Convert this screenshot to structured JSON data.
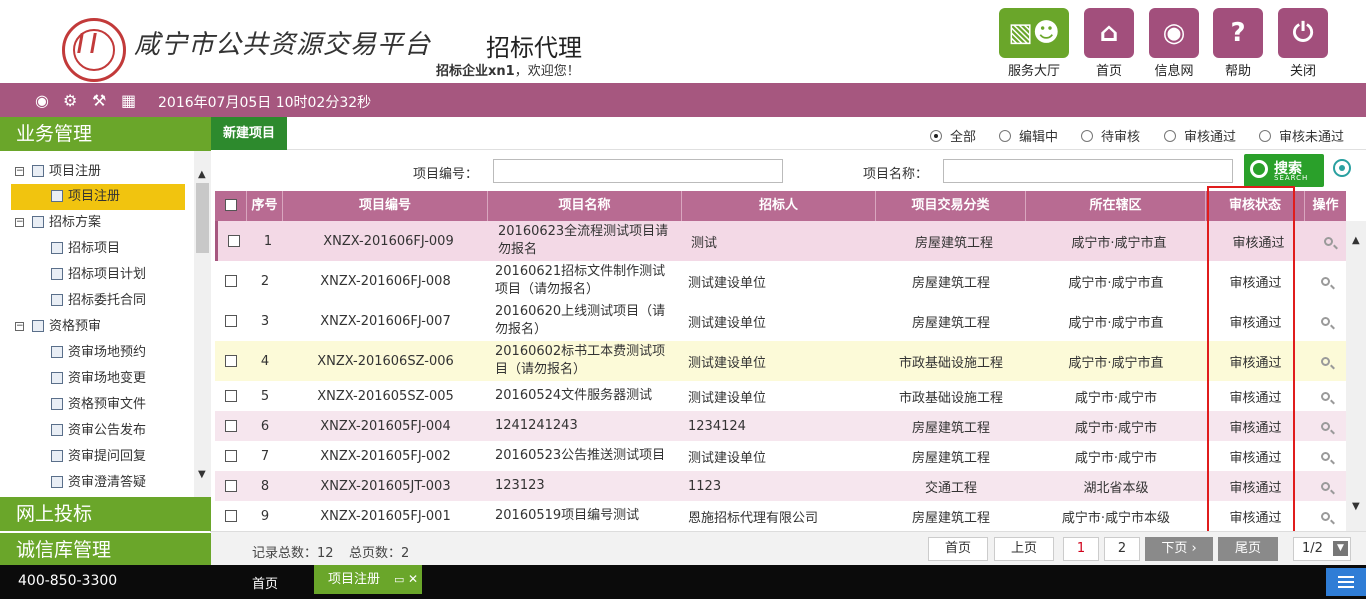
{
  "header": {
    "site_title": "咸宁市公共资源交易平台",
    "module_title": "招标代理",
    "welcome_user": "招标企业xn1",
    "welcome_text": "，欢迎您！",
    "buttons": [
      {
        "label": "服务大厅",
        "icon": "service-hall-icon"
      },
      {
        "label": "首页",
        "icon": "home-icon"
      },
      {
        "label": "信息网",
        "icon": "globe-icon"
      },
      {
        "label": "帮助",
        "icon": "help-icon"
      },
      {
        "label": "关闭",
        "icon": "power-icon"
      }
    ]
  },
  "topbar": {
    "datetime": "2016年07月05日 10时02分32秒",
    "icons": [
      "chat-icon",
      "gear-icon",
      "tools-icon",
      "gift-icon"
    ]
  },
  "sidebar": {
    "sections": [
      "业务管理",
      "网上投标",
      "诚信库管理"
    ],
    "tree": [
      {
        "label": "项目注册",
        "level": 0,
        "expand": "⊟"
      },
      {
        "label": "项目注册",
        "level": 1,
        "selected": true
      },
      {
        "label": "招标方案",
        "level": 0,
        "expand": "⊟"
      },
      {
        "label": "招标项目",
        "level": 1
      },
      {
        "label": "招标项目计划",
        "level": 1
      },
      {
        "label": "招标委托合同",
        "level": 1
      },
      {
        "label": "资格预审",
        "level": 0,
        "expand": "⊟"
      },
      {
        "label": "资审场地预约",
        "level": 1
      },
      {
        "label": "资审场地变更",
        "level": 1
      },
      {
        "label": "资格预审文件",
        "level": 1
      },
      {
        "label": "资审公告发布",
        "level": 1
      },
      {
        "label": "资审提问回复",
        "level": 1
      },
      {
        "label": "资审澄清答疑",
        "level": 1
      }
    ]
  },
  "toolbar": {
    "new_button": "新建项目",
    "filters": [
      {
        "label": "全部",
        "checked": true
      },
      {
        "label": "编辑中",
        "checked": false
      },
      {
        "label": "待审核",
        "checked": false
      },
      {
        "label": "审核通过",
        "checked": false
      },
      {
        "label": "审核未通过",
        "checked": false
      }
    ]
  },
  "search": {
    "code_label": "项目编号：",
    "code_value": "",
    "name_label": "项目名称：",
    "name_value": "",
    "button_label": "搜索",
    "button_sub": "SEARCH"
  },
  "table": {
    "headers": [
      "序号",
      "项目编号",
      "项目名称",
      "招标人",
      "项目交易分类",
      "所在辖区",
      "审核状态",
      "操作"
    ],
    "rows": [
      {
        "no": "1",
        "code": "XNZX-201606FJ-009",
        "name": "20160623全流程测试项目请勿报名",
        "tenderer": "测试",
        "category": "房屋建筑工程",
        "district": "咸宁市·咸宁市直",
        "status": "审核通过"
      },
      {
        "no": "2",
        "code": "XNZX-201606FJ-008",
        "name": "20160621招标文件制作测试项目（请勿报名）",
        "tenderer": "测试建设单位",
        "category": "房屋建筑工程",
        "district": "咸宁市·咸宁市直",
        "status": "审核通过"
      },
      {
        "no": "3",
        "code": "XNZX-201606FJ-007",
        "name": "20160620上线测试项目（请勿报名）",
        "tenderer": "测试建设单位",
        "category": "房屋建筑工程",
        "district": "咸宁市·咸宁市直",
        "status": "审核通过"
      },
      {
        "no": "4",
        "code": "XNZX-201606SZ-006",
        "name": "20160602标书工本费测试项目（请勿报名）",
        "tenderer": "测试建设单位",
        "category": "市政基础设施工程",
        "district": "咸宁市·咸宁市直",
        "status": "审核通过"
      },
      {
        "no": "5",
        "code": "XNZX-201605SZ-005",
        "name": "20160524文件服务器测试",
        "tenderer": "测试建设单位",
        "category": "市政基础设施工程",
        "district": "咸宁市·咸宁市",
        "status": "审核通过"
      },
      {
        "no": "6",
        "code": "XNZX-201605FJ-004",
        "name": "1241241243",
        "tenderer": "1234124",
        "category": "房屋建筑工程",
        "district": "咸宁市·咸宁市",
        "status": "审核通过"
      },
      {
        "no": "7",
        "code": "XNZX-201605FJ-002",
        "name": "20160523公告推送测试项目",
        "tenderer": "测试建设单位",
        "category": "房屋建筑工程",
        "district": "咸宁市·咸宁市",
        "status": "审核通过"
      },
      {
        "no": "8",
        "code": "XNZX-201605JT-003",
        "name": "123123",
        "tenderer": "1123",
        "category": "交通工程",
        "district": "湖北省本级",
        "status": "审核通过"
      },
      {
        "no": "9",
        "code": "XNZX-201605FJ-001",
        "name": "20160519项目编号测试",
        "tenderer": "恩施招标代理有限公司",
        "category": "房屋建筑工程",
        "district": "咸宁市·咸宁市本级",
        "status": "审核通过"
      }
    ]
  },
  "pager": {
    "total_records": "记录总数：12",
    "total_pages": "总页数：2",
    "first": "首页",
    "prev": "上页",
    "page1": "1",
    "page2": "2",
    "next": "下页",
    "last": "尾页",
    "page_select": "1/2"
  },
  "statusbar": {
    "phone": "400-850-3300",
    "home_tab": "首页",
    "active_tab": "项目注册"
  }
}
